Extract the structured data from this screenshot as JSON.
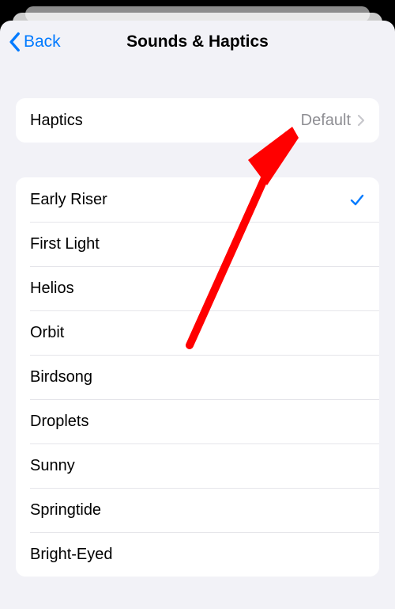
{
  "nav": {
    "back_label": "Back",
    "title": "Sounds & Haptics"
  },
  "haptics_row": {
    "label": "Haptics",
    "value": "Default"
  },
  "sounds": [
    {
      "label": "Early Riser",
      "selected": true
    },
    {
      "label": "First Light",
      "selected": false
    },
    {
      "label": "Helios",
      "selected": false
    },
    {
      "label": "Orbit",
      "selected": false
    },
    {
      "label": "Birdsong",
      "selected": false
    },
    {
      "label": "Droplets",
      "selected": false
    },
    {
      "label": "Sunny",
      "selected": false
    },
    {
      "label": "Springtide",
      "selected": false
    },
    {
      "label": "Bright-Eyed",
      "selected": false
    }
  ]
}
